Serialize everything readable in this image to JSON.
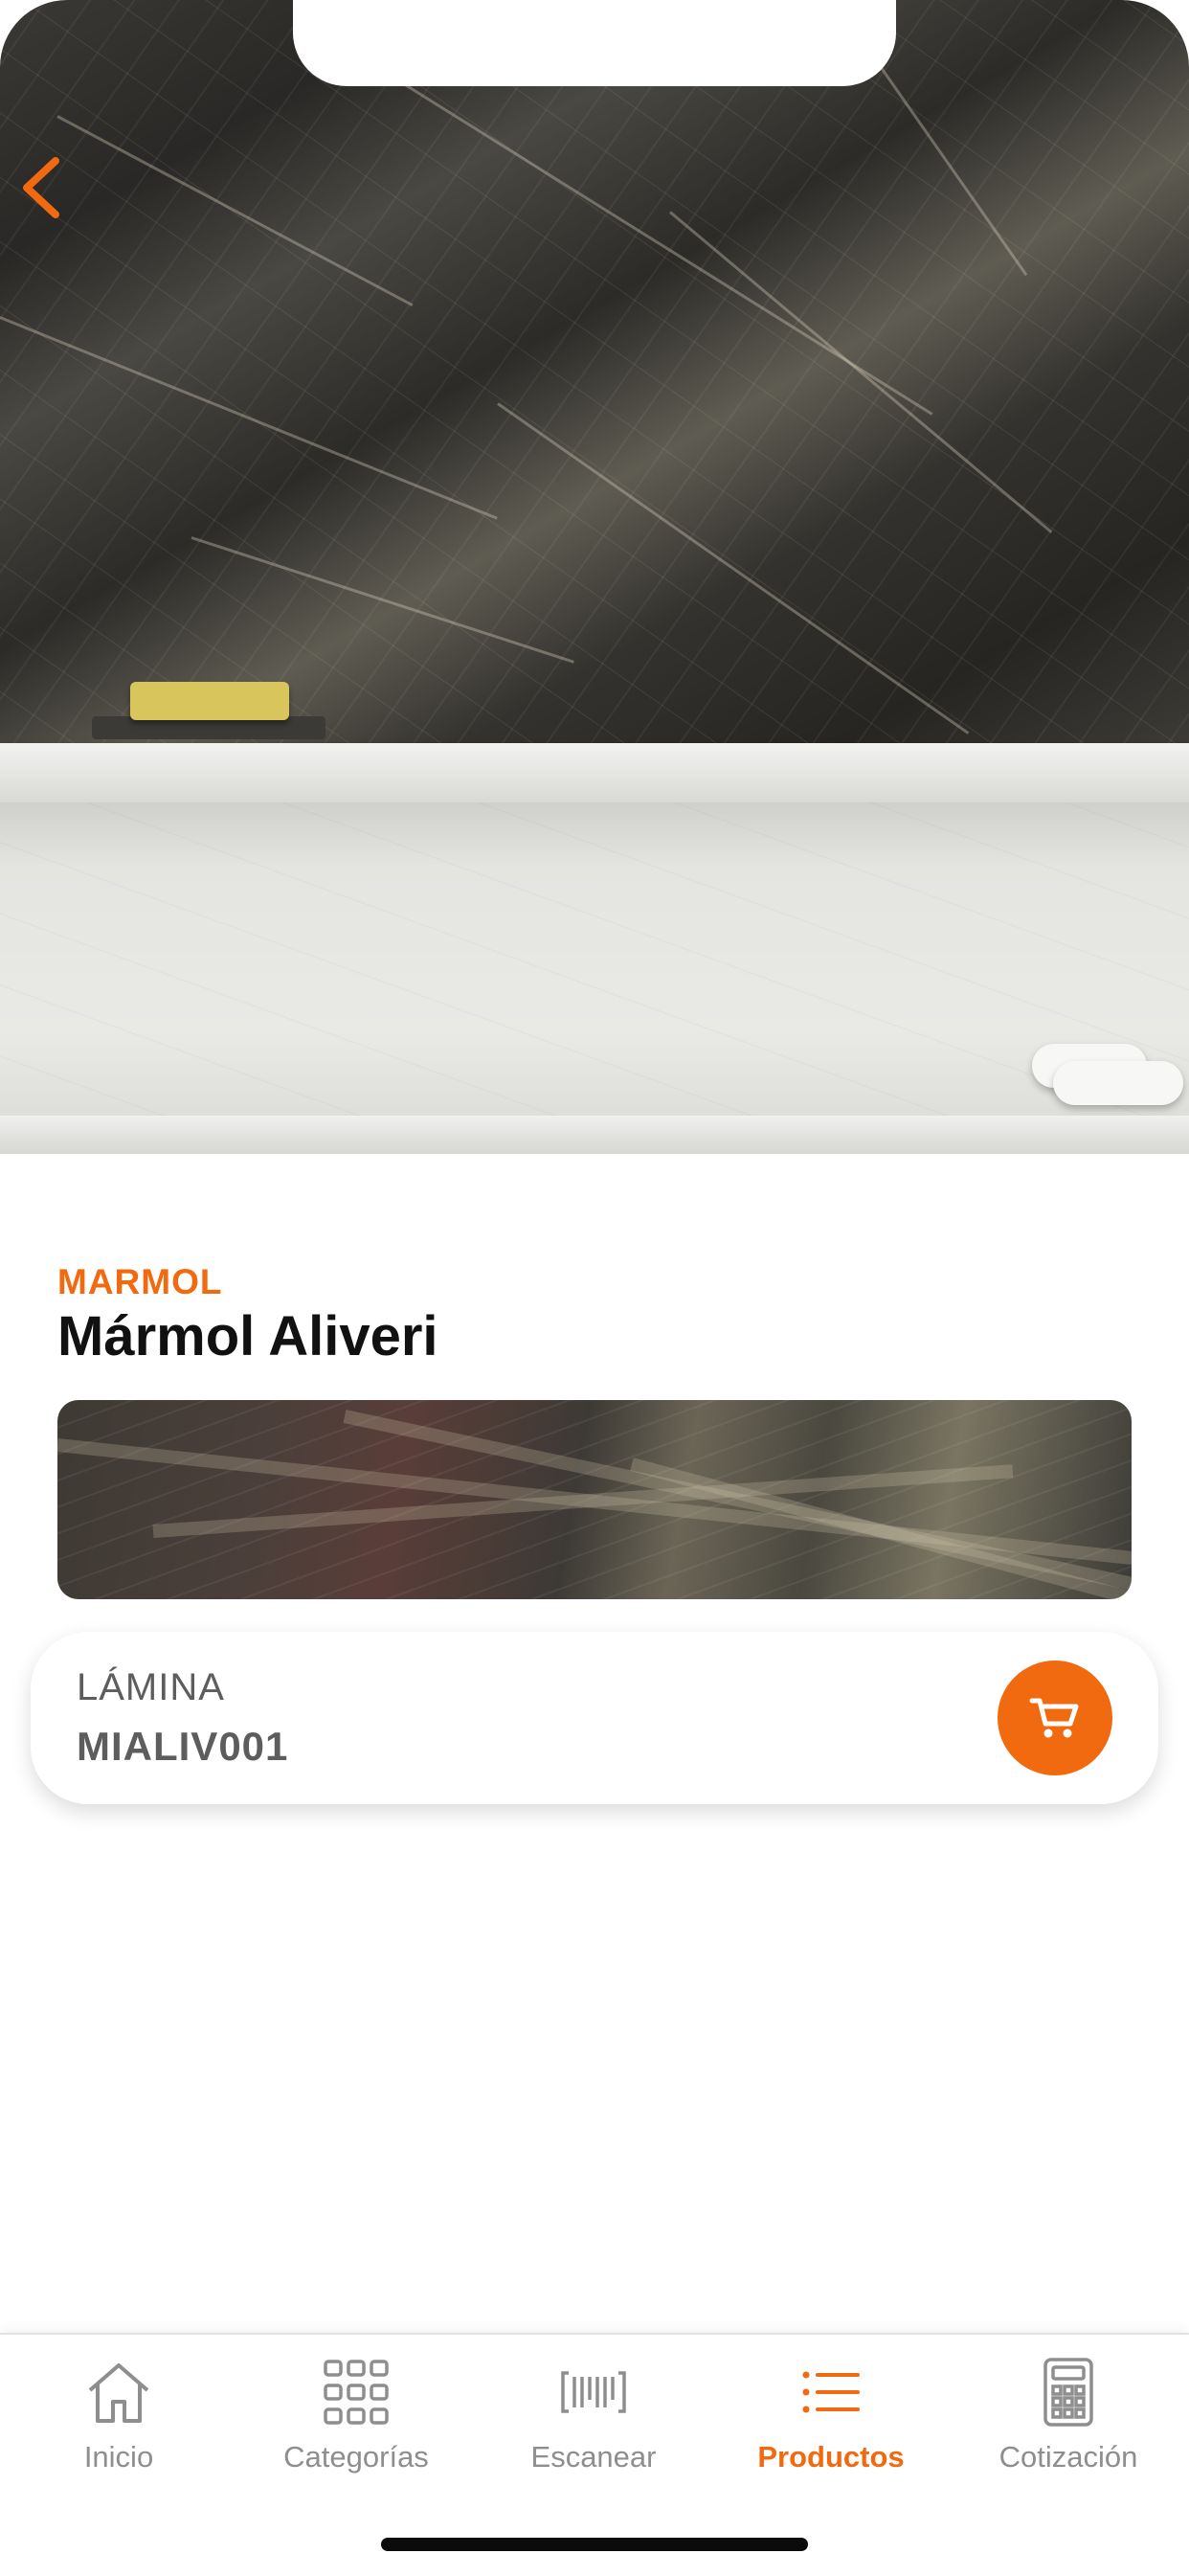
{
  "product": {
    "category": "MARMOL",
    "name": "Mármol Aliveri"
  },
  "item_card": {
    "label": "LÁMINA",
    "code": "MIALIV001"
  },
  "tabs": [
    {
      "label": "Inicio",
      "icon": "home-icon",
      "active": false
    },
    {
      "label": "Categorías",
      "icon": "grid-icon",
      "active": false
    },
    {
      "label": "Escanear",
      "icon": "barcode-icon",
      "active": false
    },
    {
      "label": "Productos",
      "icon": "list-icon",
      "active": true
    },
    {
      "label": "Cotización",
      "icon": "calculator-icon",
      "active": false
    }
  ],
  "colors": {
    "accent": "#f26a0f",
    "inactive": "#8e8e8e"
  }
}
